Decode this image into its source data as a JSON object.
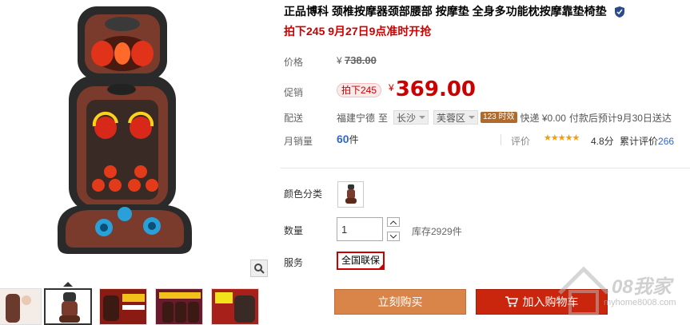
{
  "product": {
    "title": "正品博科 颈椎按摩器颈部腰部 按摩垫 全身多功能枕按摩靠垫椅垫",
    "subtitle": "拍下245 9月27日9点准时开抢"
  },
  "price": {
    "label": "价格",
    "currency": "¥",
    "original": "738.00"
  },
  "promo": {
    "label": "促销",
    "badge": "拍下245",
    "currency": "¥",
    "price": "369.00"
  },
  "shipping": {
    "label": "配送",
    "from": "福建宁德",
    "to": "至",
    "city": "长沙",
    "district": "芙蓉区",
    "time_badge": "123 时效",
    "method": "快递 ¥0.00",
    "note": "付款后预计9月30日送达"
  },
  "sales": {
    "label": "月销量",
    "count": "60",
    "unit": "件"
  },
  "reviews": {
    "label": "评价",
    "stars": "★★★★★",
    "rating": 4.8,
    "score": "4.8分",
    "count_label": "累计评价",
    "count": "266"
  },
  "options": {
    "color_label": "颜色分类",
    "quantity_label": "数量",
    "quantity_value": "1",
    "stock": "库存2929件",
    "service_label": "服务",
    "service_tag": "全国联保"
  },
  "actions": {
    "buy_now": "立刻购买",
    "add_to_cart": "加入购物车"
  },
  "watermark": {
    "text": "08我家",
    "url": "myhome8008.com"
  },
  "colors": {
    "accent_red": "#cc0000",
    "buy_orange": "#d9854a",
    "cart_red": "#c9260d",
    "link_blue": "#3366cc",
    "star_orange": "#ff9900"
  },
  "icons": [
    "zoom-icon",
    "shield-icon",
    "cart-icon",
    "dropdown-caret-icon"
  ]
}
